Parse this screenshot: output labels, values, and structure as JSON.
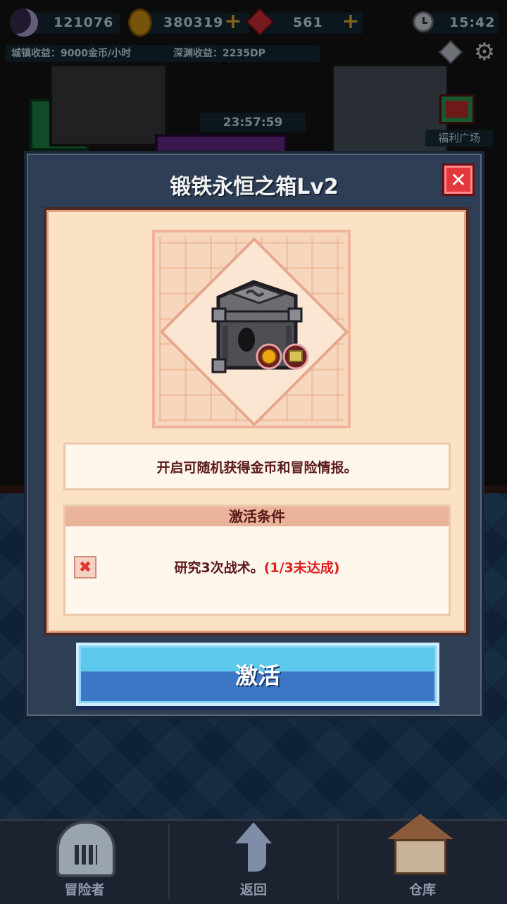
{
  "hud": {
    "gems": "121076",
    "gold": "380319",
    "rubies": "561",
    "time": "15:42",
    "town_income": "城镇收益：9000金币/小时",
    "abyss_income": "深渊收益：2235DP",
    "welfare_label": "福利广场",
    "timer": "23:57:59"
  },
  "modal": {
    "title": "锻铁永恒之箱Lv2",
    "description": "开启可随机获得金币和冒险情报。",
    "condition_header": "激活条件",
    "condition_text": "研究3次战术。",
    "condition_status": "(1/3未达成)",
    "activate_label": "激活"
  },
  "nav": {
    "adventurer": "冒险者",
    "back": "返回",
    "warehouse": "仓库"
  }
}
